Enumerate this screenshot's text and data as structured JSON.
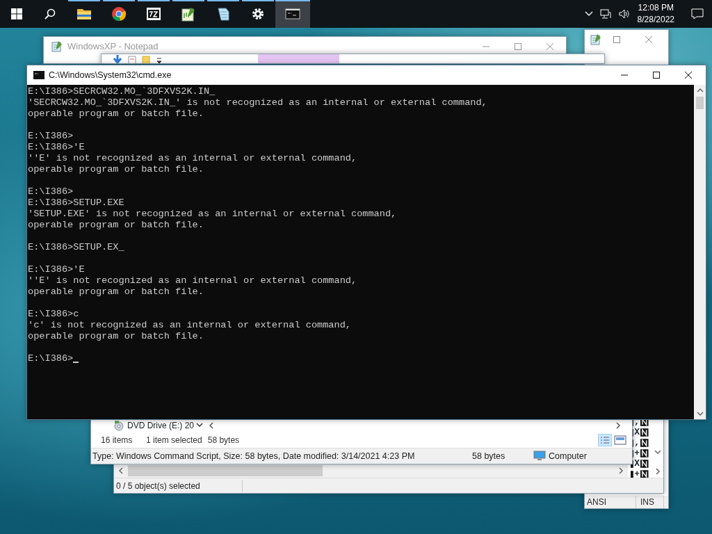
{
  "taskbar": {
    "buttons": [
      {
        "kind": "start"
      },
      {
        "kind": "search"
      }
    ],
    "apps": [
      {
        "kind": "explorer",
        "running": true,
        "selected": false
      },
      {
        "kind": "chrome",
        "running": true,
        "selected": false
      },
      {
        "kind": "sevenzip",
        "running": true,
        "selected": false
      },
      {
        "kind": "editor",
        "running": true,
        "selected": false
      },
      {
        "kind": "notepad",
        "running": true,
        "selected": false
      },
      {
        "kind": "settings",
        "running": true,
        "selected": false
      },
      {
        "kind": "console",
        "running": true,
        "selected": true
      }
    ],
    "tray": {
      "time": "12:08 PM",
      "date": "8/28/2022"
    }
  },
  "notepad_window_right": {
    "status": [
      "ANSI",
      "INS"
    ]
  },
  "notepad_window": {
    "title": "WindowsXP - Notepad"
  },
  "archive_window": {
    "glyph_rows": [
      ",",
      "X",
      ",",
      "+",
      "X",
      "+"
    ],
    "status": "0 / 5 object(s) selected"
  },
  "explorer_window": {
    "nav_item": "DVD Drive (E:) 20",
    "item_count": "16 items",
    "selection": "1 item selected",
    "selection_size": "58 bytes",
    "details": {
      "info": "Type: Windows Command Script, Size: 58 bytes, Date modified: 3/14/2021 4:23 PM",
      "size": "58 bytes",
      "location": "Computer"
    }
  },
  "cmd_window": {
    "title": "C:\\Windows\\System32\\cmd.exe",
    "blocks": [
      [
        "E:\\I386>SECRCW32.MO_`3DFXVS2K.IN_",
        "'SECRCW32.MO_`3DFXVS2K.IN_' is not recognized as an internal or external command,",
        "operable program or batch file."
      ],
      [
        "E:\\I386>",
        "E:\\I386>'E",
        "''E' is not recognized as an internal or external command,",
        "operable program or batch file."
      ],
      [
        "E:\\I386>",
        "E:\\I386>SETUP.EXE",
        "'SETUP.EXE' is not recognized as an internal or external command,",
        "operable program or batch file."
      ],
      [
        "E:\\I386>SETUP.EX_"
      ],
      [
        "E:\\I386>'E",
        "''E' is not recognized as an internal or external command,",
        "operable program or batch file."
      ],
      [
        "E:\\I386>c",
        "'c' is not recognized as an internal or external command,",
        "operable program or batch file."
      ],
      [
        "E:\\I386>"
      ]
    ]
  }
}
